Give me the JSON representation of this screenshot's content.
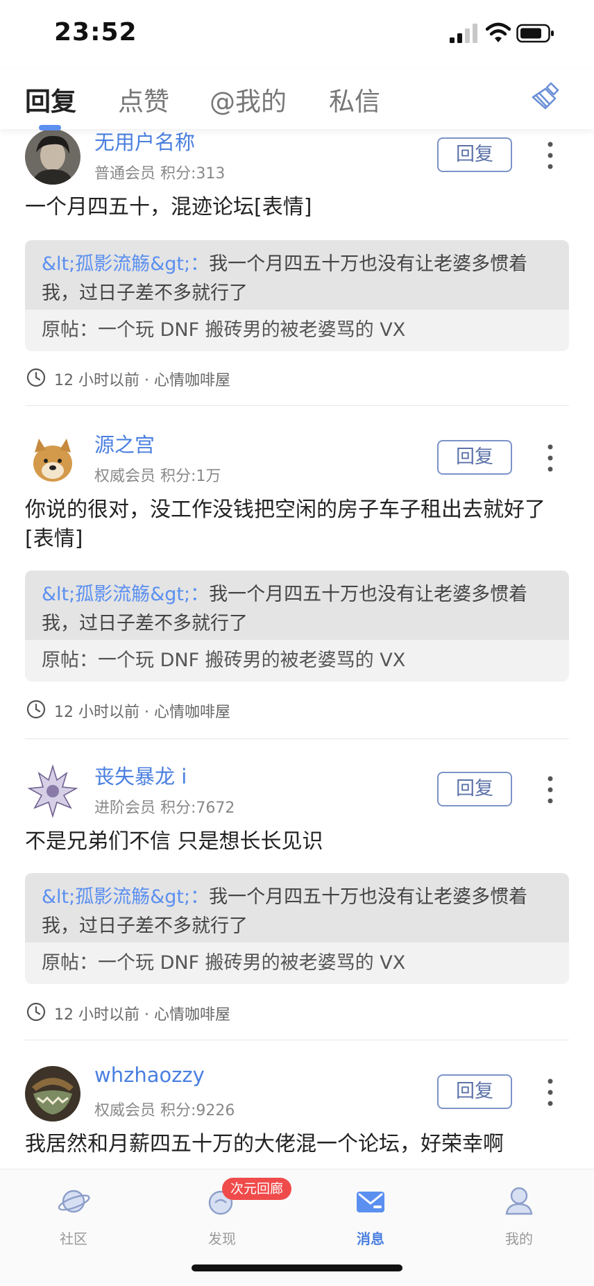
{
  "status": {
    "time": "23:52"
  },
  "tabs": [
    {
      "label": "回复",
      "active": true
    },
    {
      "label": "点赞"
    },
    {
      "label": "@我的"
    },
    {
      "label": "私信"
    }
  ],
  "posts": [
    {
      "username": "无用户名称",
      "rank": "普通会员",
      "points": "积分:313",
      "reply_label": "回复",
      "content": "一个月四五十，混迹论坛[表情]",
      "quote_author": "&lt;孤影流觞&gt;：",
      "quote_text": "我一个月四五十万也没有让老婆多惯着我，过日子差不多就行了",
      "original": "原帖：一个玩 DNF 搬砖男的被老婆骂的 VX",
      "time": "12 小时以前",
      "forum": "心情咖啡屋"
    },
    {
      "username": "源之宫",
      "rank": "权威会员",
      "points": "积分:1万",
      "reply_label": "回复",
      "content": "你说的很对，没工作没钱把空闲的房子车子租出去就好了[表情]",
      "quote_author": "&lt;孤影流觞&gt;：",
      "quote_text": "我一个月四五十万也没有让老婆多惯着我，过日子差不多就行了",
      "original": "原帖：一个玩 DNF 搬砖男的被老婆骂的 VX",
      "time": "12 小时以前",
      "forum": "心情咖啡屋"
    },
    {
      "username": "丧失暴龙 i",
      "rank": "进阶会员",
      "points": "积分:7672",
      "reply_label": "回复",
      "content": "不是兄弟们不信 只是想长长见识",
      "quote_author": "&lt;孤影流觞&gt;：",
      "quote_text": "我一个月四五十万也没有让老婆多惯着我，过日子差不多就行了",
      "original": "原帖：一个玩 DNF 搬砖男的被老婆骂的 VX",
      "time": "12 小时以前",
      "forum": "心情咖啡屋"
    },
    {
      "username": "whzhaozzy",
      "rank": "权威会员",
      "points": "积分:9226",
      "reply_label": "回复",
      "content": "我居然和月薪四五十万的大佬混一个论坛，好荣幸啊"
    }
  ],
  "meta_sep": "·",
  "bottom_nav": [
    {
      "label": "社区",
      "icon": "planet-icon"
    },
    {
      "label": "发现",
      "icon": "discover-icon",
      "badge": "次元回廊"
    },
    {
      "label": "消息",
      "icon": "mail-icon",
      "active": true
    },
    {
      "label": "我的",
      "icon": "profile-icon"
    }
  ],
  "colors": {
    "accent": "#4a7fe0",
    "badge": "#f04b4b",
    "quote_bg": "#e4e4e4",
    "original_bg": "#f2f2f2"
  }
}
